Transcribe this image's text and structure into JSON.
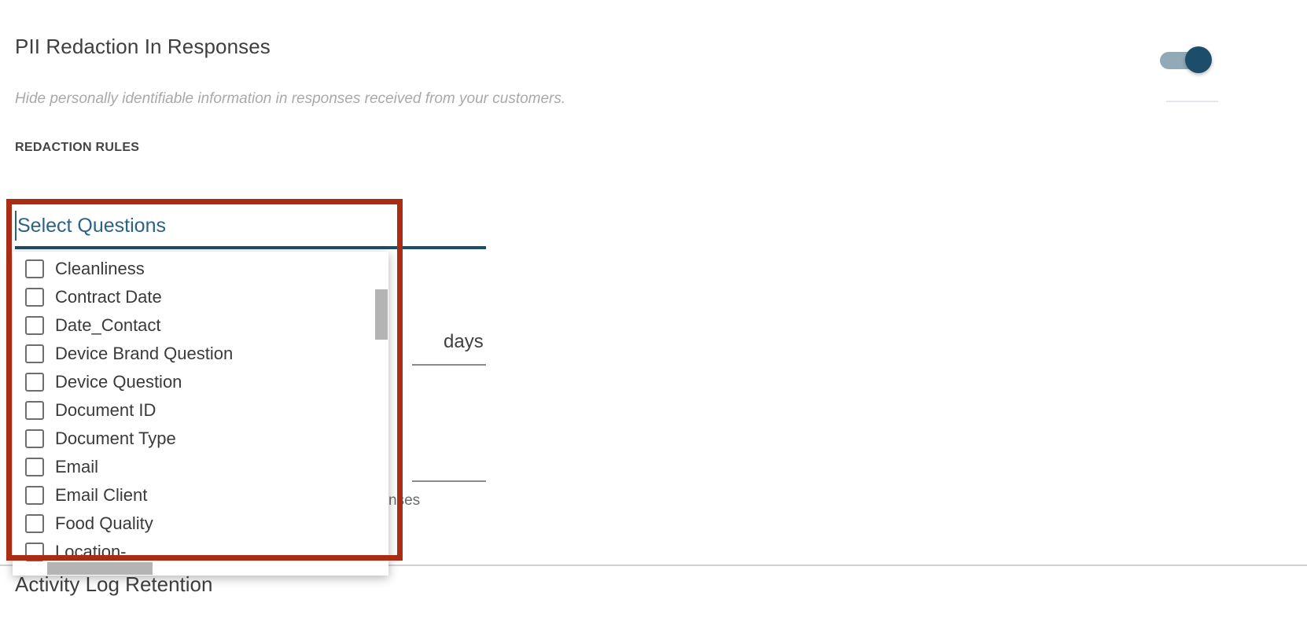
{
  "section": {
    "title": "PII Redaction In Responses",
    "description": "Hide personally identifiable information in responses received from your customers.",
    "rules_label": "REDACTION RULES"
  },
  "toggle": {
    "name": "pii-redaction-toggle",
    "state": "on",
    "track_color": "#92a9b8",
    "thumb_color": "#1c4e6b"
  },
  "select": {
    "label": "Select Questions",
    "placeholder": "Select Questions",
    "value": "",
    "label_color": "#2b6384",
    "underline_color": "#1d4e68",
    "expanded": "true"
  },
  "dropdown": {
    "items": [
      {
        "label": "Cleanliness",
        "checked": "false"
      },
      {
        "label": "Contract Date",
        "checked": "false"
      },
      {
        "label": "Date_Contact",
        "checked": "false"
      },
      {
        "label": "Device Brand Question",
        "checked": "false"
      },
      {
        "label": "Device Question",
        "checked": "false"
      },
      {
        "label": "Document ID",
        "checked": "false"
      },
      {
        "label": "Document Type",
        "checked": "false"
      },
      {
        "label": "Email",
        "checked": "false"
      },
      {
        "label": "Email Client",
        "checked": "false"
      },
      {
        "label": "Food Quality",
        "checked": "false"
      },
      {
        "label": "Location-",
        "checked": "false"
      }
    ]
  },
  "annotation": {
    "color": "#aa2c13"
  },
  "background": {
    "days_unit": "days",
    "partial_responses_text": "nses",
    "next_section_title": "Activity Log Retention"
  }
}
